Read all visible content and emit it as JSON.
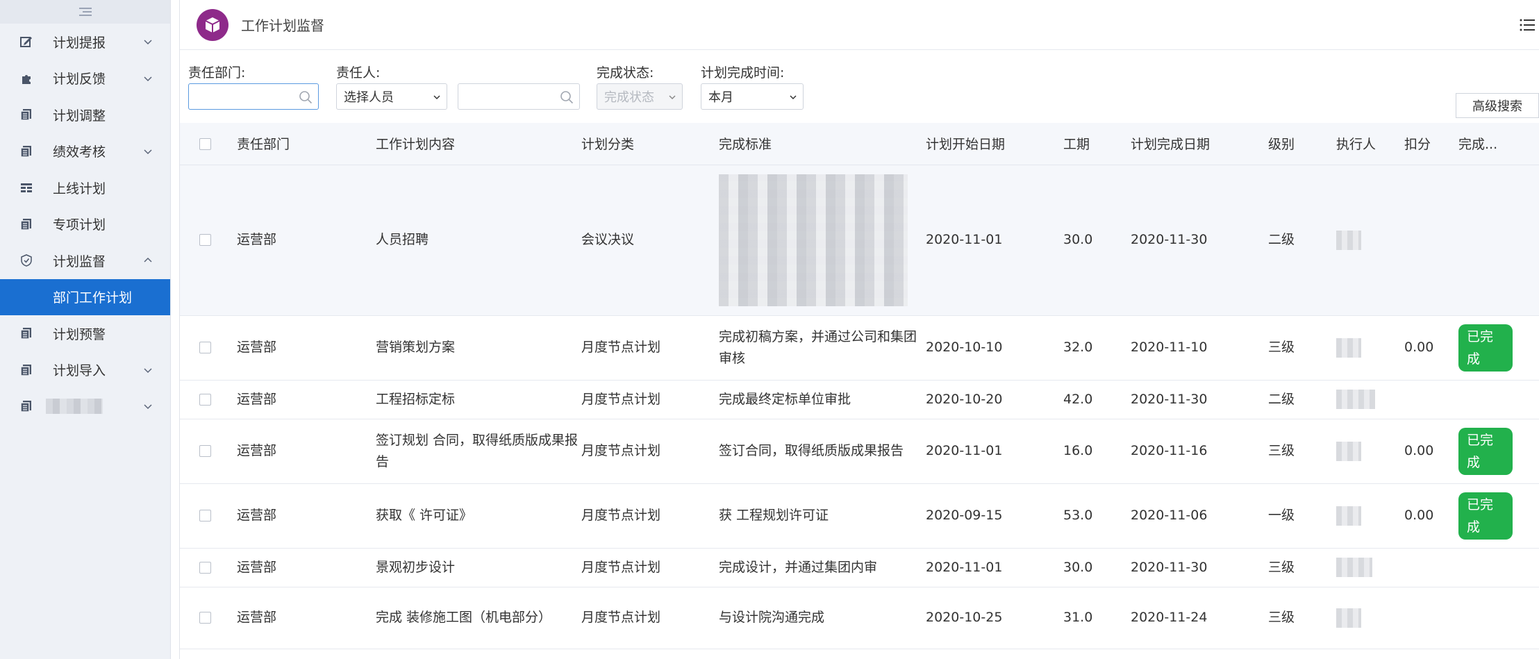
{
  "sidebar": {
    "items": [
      {
        "label": "计划提报",
        "icon": "edit-icon",
        "chevron": "down"
      },
      {
        "label": "计划反馈",
        "icon": "puzzle-icon",
        "chevron": "down"
      },
      {
        "label": "计划调整",
        "icon": "document-icon",
        "chevron": ""
      },
      {
        "label": "绩效考核",
        "icon": "document-icon",
        "chevron": "down"
      },
      {
        "label": "上线计划",
        "icon": "grid-icon",
        "chevron": ""
      },
      {
        "label": "专项计划",
        "icon": "document-icon",
        "chevron": ""
      },
      {
        "label": "计划监督",
        "icon": "shield-icon",
        "chevron": "up"
      },
      {
        "label": "部门工作计划",
        "icon": "",
        "chevron": "",
        "active": true
      },
      {
        "label": "计划预警",
        "icon": "document-icon",
        "chevron": ""
      },
      {
        "label": "计划导入",
        "icon": "document-icon",
        "chevron": "down"
      },
      {
        "label": "",
        "icon": "document-icon",
        "chevron": "down"
      }
    ]
  },
  "header": {
    "title": "工作计划监督"
  },
  "filters": {
    "dept_label": "责任部门:",
    "dept_value": "",
    "person_label": "责任人:",
    "person_select": "选择人员",
    "person_value": "",
    "status_label": "完成状态:",
    "status_placeholder": "完成状态",
    "time_label": "计划完成时间:",
    "time_value": "本月",
    "advanced_search": "高级搜索"
  },
  "table": {
    "columns": [
      "责任部门",
      "工作计划内容",
      "计划分类",
      "完成标准",
      "计划开始日期",
      "工期",
      "计划完成日期",
      "级别",
      "执行人",
      "扣分",
      "完成..."
    ],
    "rows": [
      {
        "dept": "运营部",
        "content": "人员招聘",
        "category": "会议决议",
        "standard": "",
        "start": "2020-11-01",
        "duration": "30.0",
        "end": "2020-11-30",
        "level": "二级",
        "score": "",
        "status": ""
      },
      {
        "dept": "运营部",
        "content": "营销策划方案",
        "category": "月度节点计划",
        "standard": "完成初稿方案，并通过公司和集团审核",
        "start": "2020-10-10",
        "duration": "32.0",
        "end": "2020-11-10",
        "level": "三级",
        "score": "0.00",
        "status": "已完成"
      },
      {
        "dept": "运营部",
        "content": "工程招标定标",
        "category": "月度节点计划",
        "standard": "完成最终定标单位审批",
        "start": "2020-10-20",
        "duration": "42.0",
        "end": "2020-11-30",
        "level": "二级",
        "score": "",
        "status": ""
      },
      {
        "dept": "运营部",
        "content": "签订规划 合同，取得纸质版成果报告",
        "category": "月度节点计划",
        "standard": "签订合同，取得纸质版成果报告",
        "start": "2020-11-01",
        "duration": "16.0",
        "end": "2020-11-16",
        "level": "三级",
        "score": "0.00",
        "status": "已完成"
      },
      {
        "dept": "运营部",
        "content": "获取《 许可证》",
        "category": "月度节点计划",
        "standard": "获 工程规划许可证",
        "start": "2020-09-15",
        "duration": "53.0",
        "end": "2020-11-06",
        "level": "一级",
        "score": "0.00",
        "status": "已完成"
      },
      {
        "dept": "运营部",
        "content": "景观初步设计",
        "category": "月度节点计划",
        "standard": "完成设计，并通过集团内审",
        "start": "2020-11-01",
        "duration": "30.0",
        "end": "2020-11-30",
        "level": "三级",
        "score": "",
        "status": ""
      },
      {
        "dept": "运营部",
        "content": "完成 装修施工图（机电部分）",
        "category": "月度节点计划",
        "standard": "与设计院沟通完成",
        "start": "2020-10-25",
        "duration": "31.0",
        "end": "2020-11-24",
        "level": "三级",
        "score": "",
        "status": ""
      }
    ]
  },
  "colors": {
    "accent": "#1a6fd1",
    "success": "#22b14c",
    "logo": "#8e2a8a"
  }
}
